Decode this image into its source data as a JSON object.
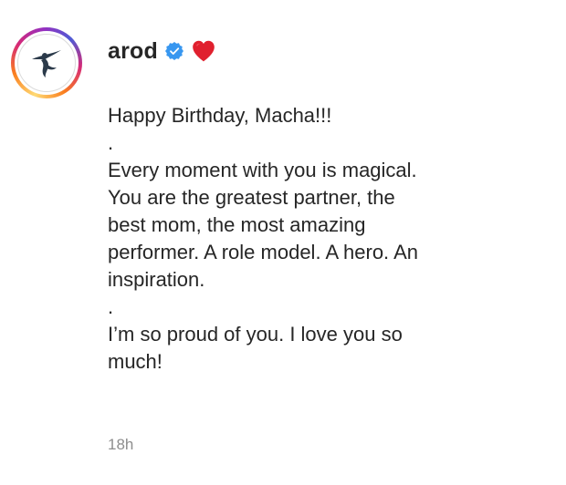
{
  "post": {
    "username": "arod",
    "verified": true,
    "emoji": "heart",
    "caption_lines": [
      "Happy Birthday, Macha!!!",
      ".",
      "Every moment with you is magical.",
      "You are the greatest partner, the",
      "best mom, the most amazing",
      "performer. A role model. A hero. An",
      "inspiration.",
      ".",
      "I’m so proud of you. I love you so",
      "much!"
    ],
    "timestamp": "18h"
  },
  "icons": {
    "avatar": "batter-silhouette-logo",
    "verified": "verified-badge-icon",
    "emoji": "red-heart-icon"
  },
  "colors": {
    "verified_blue": "#3897f0",
    "heart_red": "#e0202e",
    "text": "#262626",
    "muted": "#8e8e8e"
  }
}
